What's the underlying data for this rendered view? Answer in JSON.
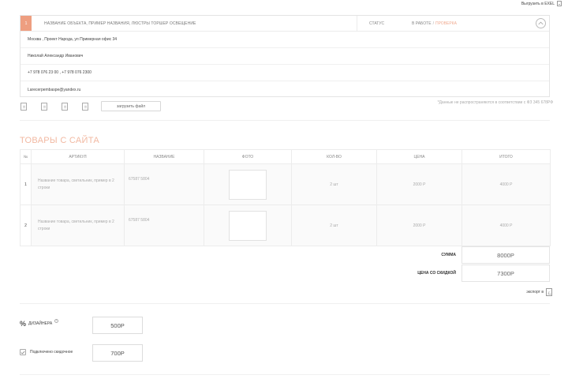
{
  "top": {
    "export_label": "Выгрузить в EXEL"
  },
  "order": {
    "number": "1",
    "name": "НАЗВАНИЕ ОБЪЕКТА, ПРИМЕР НАЗВАНИЯ, ЛЮСТРЫ ТОРШЕР ОСВЕЩЕНИЕ",
    "status_label": "СТАТУС",
    "status_value": "В РАБОТЕ",
    "status_separator": "/",
    "status_alt": "ПРОВЕРКА",
    "address": "Москва , Проект Народа, ул Примерная офис 34",
    "contact_name": "Николай Александр Иванович",
    "phones": "+7 978 076 23 00 , +7 978 076 2300",
    "email": "Larecerpembaspe@yandex.ru"
  },
  "files": {
    "upload_label": "загрузить файл",
    "note": "*Данные не распространяются в соответствии с ФЗ 345 678РФ"
  },
  "section": {
    "title": "ТОВАРЫ С САЙТА"
  },
  "table": {
    "headers": [
      "№",
      "АРТИКУЛ",
      "НАЗВАНИЕ",
      "ФОТО",
      "КОЛ-ВО",
      "ЦЕНА",
      "ИТОГО"
    ],
    "rows": [
      {
        "num": "1",
        "article": "Название товара, светильник, пример в 2 строки",
        "name": "67587 5804",
        "qty": "2 шт",
        "price": "2000 Р",
        "total": "4000 Р"
      },
      {
        "num": "2",
        "article": "Название товара, светильник, пример в 2 строки",
        "name": "67587 5804",
        "qty": "2 шт",
        "price": "2000 Р",
        "total": "4000 Р"
      }
    ]
  },
  "totals": {
    "sum_label": "СУММА",
    "sum_value": "8000Р",
    "discount_label": "ЦЕНА СО СКИДКОЙ",
    "discount_value": "7300Р"
  },
  "export_small": {
    "label": "экспорт в"
  },
  "extras": {
    "discount_label": "ДИЗАЙНЕРА",
    "discount_value": "500Р",
    "discount_info": "i",
    "agree_label": "Подключено скидочное",
    "agree_value": "700Р"
  }
}
